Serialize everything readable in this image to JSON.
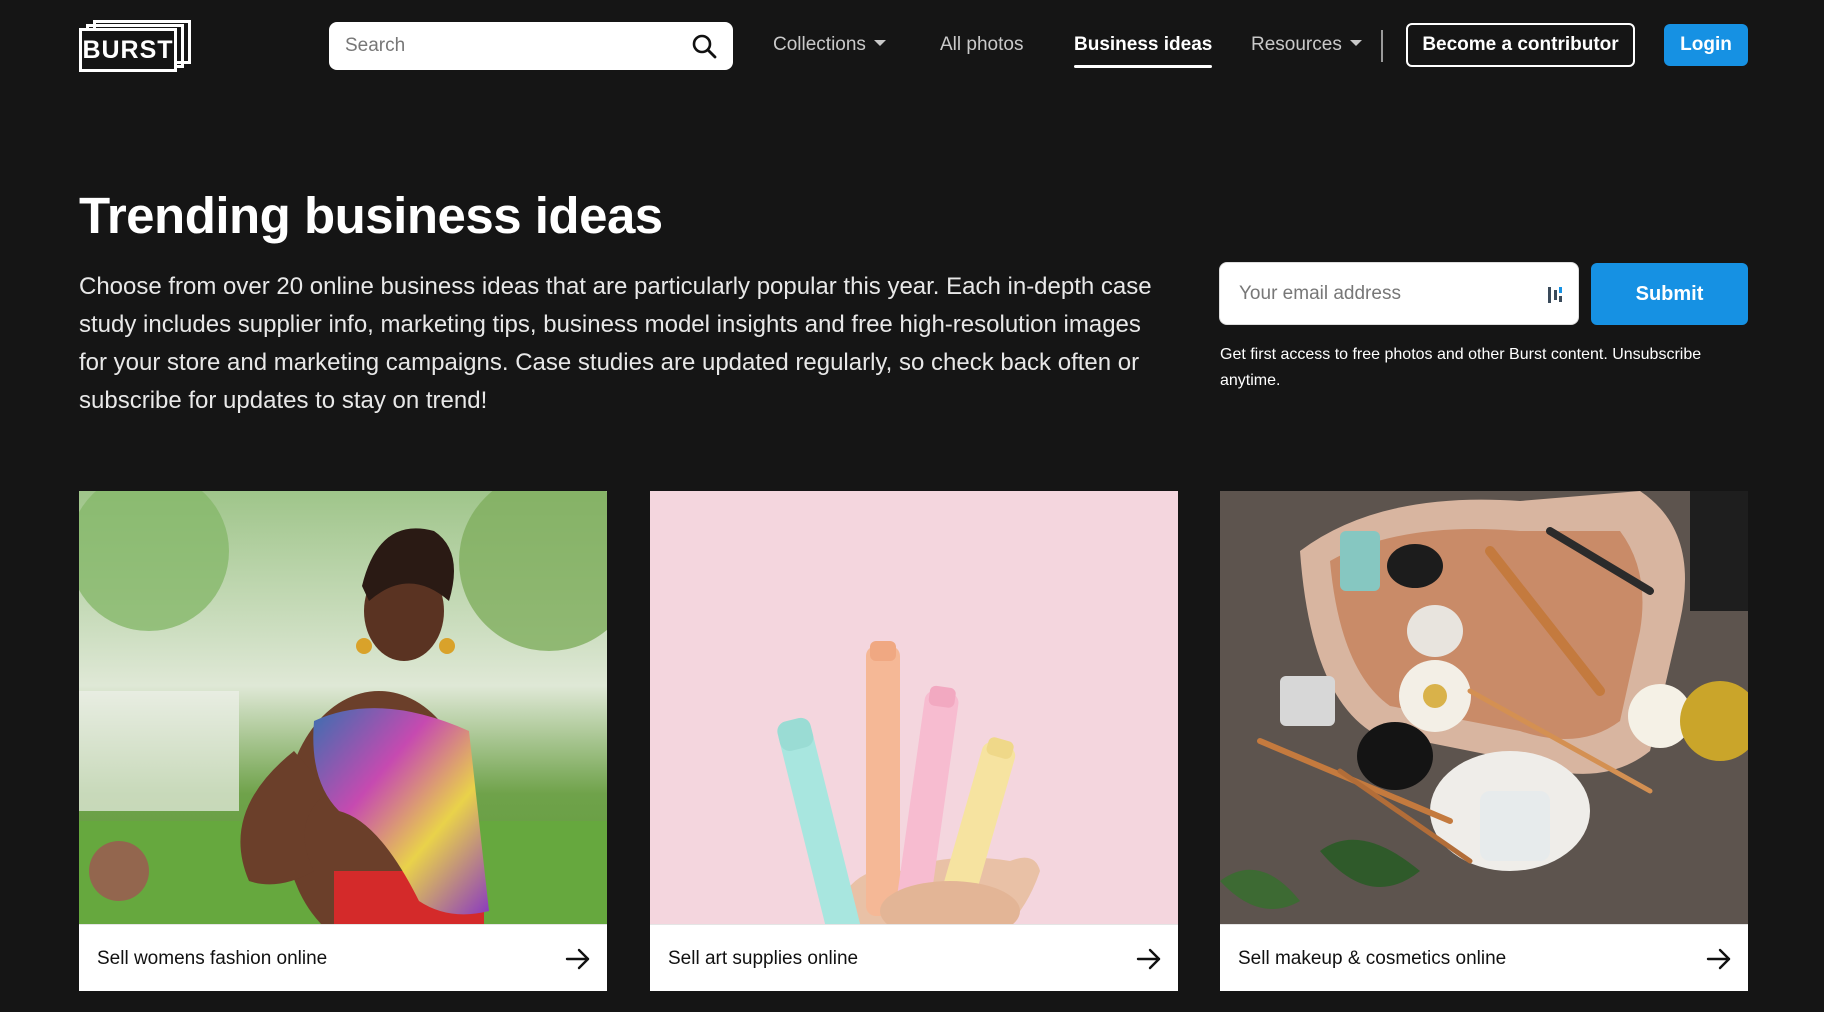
{
  "header": {
    "logo_text": "BURST",
    "search": {
      "placeholder": "Search"
    },
    "nav": [
      {
        "label": "Collections",
        "has_caret": true
      },
      {
        "label": "All photos"
      },
      {
        "label": "Business ideas",
        "active": true
      },
      {
        "label": "Resources",
        "has_caret": true
      }
    ],
    "contribute_label": "Become a contributor",
    "login_label": "Login"
  },
  "hero": {
    "title": "Trending business ideas",
    "description": "Choose from over 20 online business ideas that are particularly popular this year. Each in-depth case study includes supplier info, marketing tips, business model insights and free high-resolution images for your store and marketing campaigns. Case studies are updated regularly, so check back often or subscribe for updates to stay on trend!"
  },
  "subscribe": {
    "email_placeholder": "Your email address",
    "submit_label": "Submit",
    "note": "Get first access to free photos and other Burst content. Unsubscribe anytime."
  },
  "cards": [
    {
      "title": "Sell womens fashion online",
      "image": "woman-in-colorful-scarf-photo"
    },
    {
      "title": "Sell art supplies online",
      "image": "pastel-markers-photo"
    },
    {
      "title": "Sell makeup & cosmetics online",
      "image": "makeup-flatlay-photo"
    }
  ],
  "colors": {
    "background": "#151515",
    "accent": "#1691e3",
    "text": "#ffffff"
  }
}
